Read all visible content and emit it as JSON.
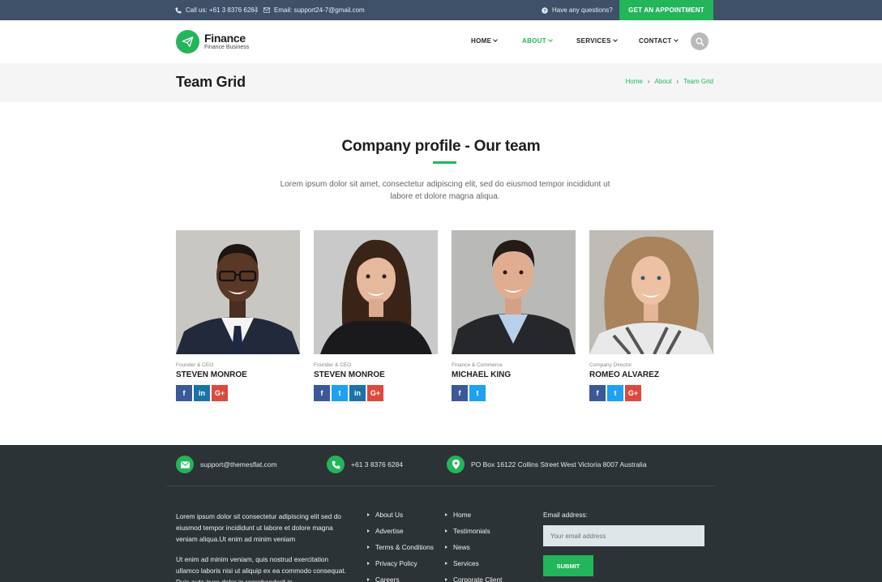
{
  "topbar": {
    "call_us": "Call us: +61 3 8376 6284",
    "email": "Email: support24-7@gmail.com",
    "questions": "Have any questions?",
    "appointment_label": "GET AN APPOINTMENT"
  },
  "header": {
    "brand": "Finance",
    "tagline": "Finance Business",
    "nav": [
      {
        "label": "HOME",
        "active": false
      },
      {
        "label": "ABOUT",
        "active": true
      },
      {
        "label": "SERVICES",
        "active": false
      },
      {
        "label": "CONTACT",
        "active": false
      }
    ]
  },
  "page": {
    "title": "Team Grid",
    "breadcrumb": [
      "Home",
      "About",
      "Team Grid"
    ]
  },
  "section": {
    "title": "Company profile - Our team",
    "description": "Lorem ipsum dolor sit amet, consectetur adipiscing elit, sed do eiusmod tempor incididunt ut labore et dolore magna aliqua."
  },
  "team": [
    {
      "role": "Founder & CEO",
      "name": "STEVEN MONROE",
      "socials": [
        "facebook-icon",
        "linkedin-icon",
        "google-plus-icon"
      ]
    },
    {
      "role": "Founder & CEO",
      "name": "STEVEN MONROE",
      "socials": [
        "facebook-icon",
        "twitter-icon",
        "linkedin-icon",
        "google-plus-icon"
      ]
    },
    {
      "role": "Finance & Commerce",
      "name": "MICHAEL KING",
      "socials": [
        "facebook-icon",
        "twitter-icon"
      ]
    },
    {
      "role": "Company Director",
      "name": "ROMEO ALVAREZ",
      "socials": [
        "facebook-icon",
        "twitter-icon",
        "google-plus-icon"
      ]
    }
  ],
  "footer": {
    "email": "support@themesflat.com",
    "phone": "+61 3 8376 6284",
    "address": "PO Box 16122 Collins Street West Victoria 8007 Australia",
    "about_p1": "Lorem ipsum dolor sit consectetur adipiscing elit sed do eiusmod tempor incididunt ut labore et dolore magna veniam aliqua.Ut enim ad minim veniam",
    "about_p2": "Ut enim ad minim veniam, quis nostrud exercitation ullamco laboris nisi ut aliquip ex ea commodo consequat. Duis aute irure dolor in reprehenderit in",
    "links_col1": [
      "About Us",
      "Advertise",
      "Terms & Conditions",
      "Privacy Policy",
      "Careers"
    ],
    "links_col2": [
      "Home",
      "Testimonials",
      "News",
      "Services",
      "Corporate Client"
    ],
    "email_label": "Email address:",
    "email_placeholder": "Your email address",
    "submit_label": "SUBMIT"
  },
  "colors": {
    "accent": "#23b55a",
    "topbar": "#3f5069",
    "footer": "#2c3336"
  }
}
